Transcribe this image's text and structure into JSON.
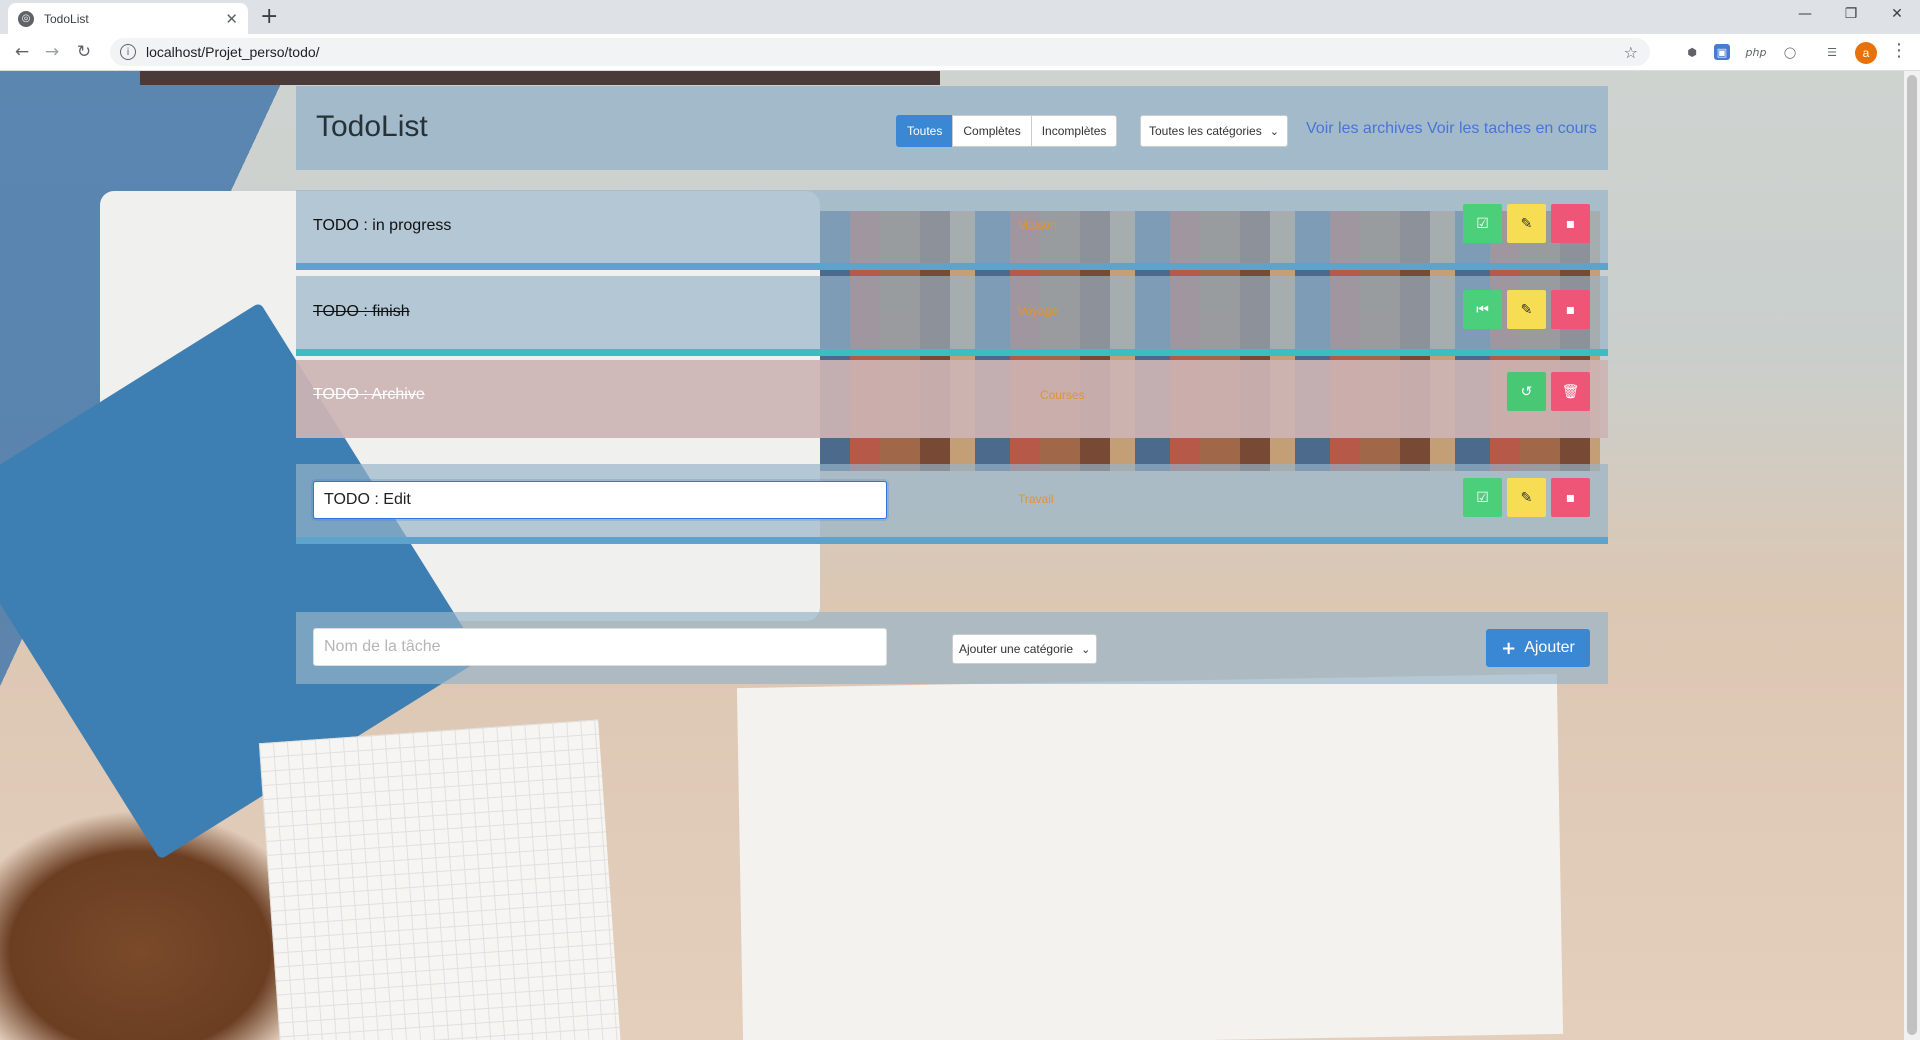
{
  "browser": {
    "tab_title": "TodoList",
    "new_tab": "+",
    "url": "localhost/Projet_perso/todo/"
  },
  "header": {
    "title": "TodoList",
    "filters": [
      "Toutes",
      "Complètes",
      "Incomplètes"
    ],
    "category_select": "Toutes les catégories",
    "archives_link": "Voir les archives",
    "ongoing_link": "Voir les taches en cours"
  },
  "todos": [
    {
      "text": "TODO : in progress",
      "category": "Maison",
      "state": "in-progress"
    },
    {
      "text": "TODO : finish",
      "category": "Voyage",
      "state": "done"
    },
    {
      "text": "TODO : Archive",
      "category": "Courses",
      "state": "archived"
    },
    {
      "text": "TODO : Edit",
      "category": "Travail",
      "state": "editing"
    }
  ],
  "add_form": {
    "placeholder": "Nom de la tâche",
    "category_select": "Ajouter une catégorie",
    "submit_label": "Ajouter"
  },
  "colors": {
    "primary": "#3a87d3",
    "success": "#4ccf7b",
    "warning": "#f7dd54",
    "danger": "#ef5577",
    "category_text": "#e39330"
  }
}
